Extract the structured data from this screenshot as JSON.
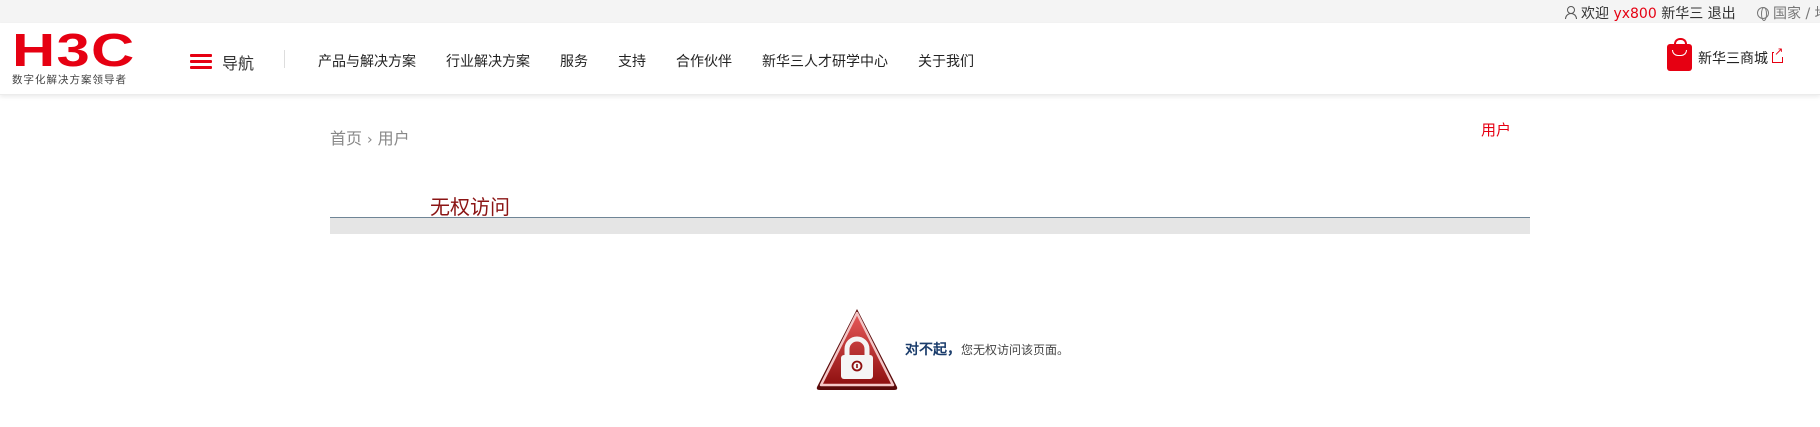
{
  "topbar": {
    "welcome_prefix": "欢迎",
    "username": "yx800",
    "company": "新华三",
    "logout": "退出",
    "language": "国家 / 地"
  },
  "header": {
    "logo_text": "H3C",
    "logo_tagline": "数字化解决方案领导者",
    "nav_toggle_label": "导航",
    "menu": [
      "产品与解决方案",
      "行业解决方案",
      "服务",
      "支持",
      "合作伙伴",
      "新华三人才研学中心",
      "关于我们"
    ],
    "shop_label": "新华三商城"
  },
  "breadcrumb": {
    "home": "首页",
    "separator": "›",
    "current": "用户"
  },
  "user_link": "用户",
  "panel": {
    "title": "无权访问",
    "message_strong": "对不起，",
    "message_rest": "您无权访问该页面。"
  },
  "colors": {
    "brand_red": "#e60012",
    "title_red": "#8b1414",
    "message_blue": "#1a3c6b"
  },
  "icons": [
    "user-icon",
    "globe-icon",
    "hamburger-icon",
    "shopping-bag-icon",
    "external-link-icon",
    "lock-warning-icon"
  ]
}
